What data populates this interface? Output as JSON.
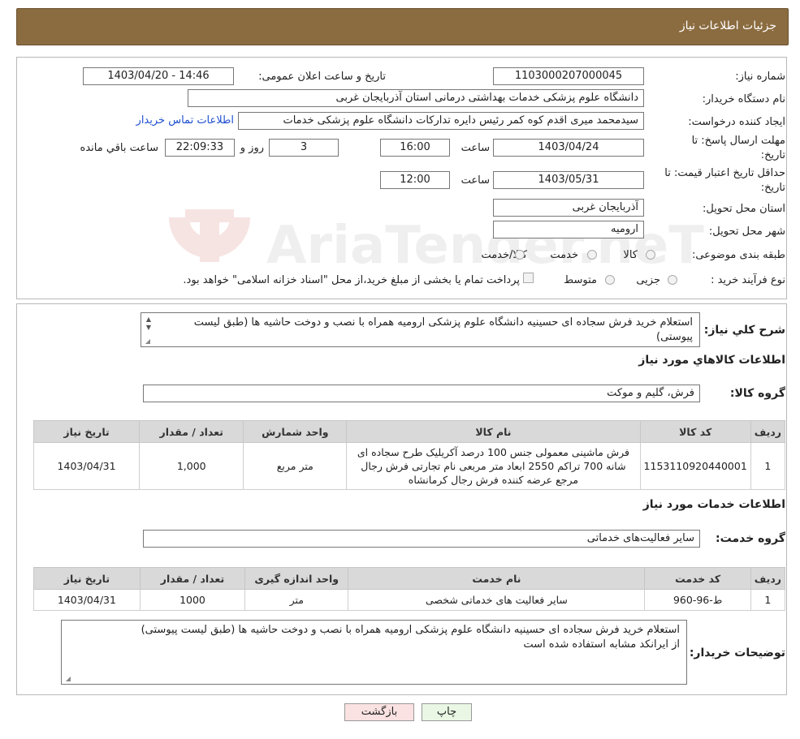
{
  "header": {
    "title": "جزئیات اطلاعات نیاز"
  },
  "watermark": {
    "text": "AriaTender.neT"
  },
  "info": {
    "need_number_label": "شماره نیاز:",
    "need_number": "1103000207000045",
    "announce_label": "تاریخ و ساعت اعلان عمومی:",
    "announce_value": "1403/04/20 - 14:46",
    "buyer_org_label": "نام دستگاه خریدار:",
    "buyer_org": "دانشگاه علوم پزشکی خدمات بهداشتی درمانی استان آذربایجان غربی",
    "creator_label": "ایجاد کننده درخواست:",
    "creator": "سیدمحمد میری اقدم کوه کمر رئیس دایره تدارکات دانشگاه علوم پزشکی خدمات",
    "contact_link": "اطلاعات تماس خریدار",
    "deadline_label_1": "مهلت ارسال پاسخ: تا",
    "deadline_label_2": "تاریخ:",
    "deadline_date": "1403/04/24",
    "time_label": "ساعت",
    "deadline_time": "16:00",
    "days_count": "3",
    "days_label": "روز و",
    "remaining_time": "22:09:33",
    "remaining_label": "ساعت باقي مانده",
    "validity_label_1": "حداقل تاریخ اعتبار قیمت: تا",
    "validity_label_2": "تاریخ:",
    "validity_date": "1403/05/31",
    "validity_time": "12:00",
    "province_label": "استان محل تحویل:",
    "province": "آذربایجان غربی",
    "city_label": "شهر محل تحویل:",
    "city": "ارومیه",
    "category_label": "طبقه بندی موضوعی:",
    "category_options": [
      "کالا",
      "خدمت",
      "کالا/خدمت"
    ],
    "process_label": "نوع فرآیند خرید :",
    "process_options": [
      "جزیی",
      "متوسط"
    ],
    "process_note": "پرداخت تمام یا بخشی از مبلغ خرید،از محل \"اسناد خزانه اسلامی\" خواهد بود."
  },
  "summary": {
    "label": "شرح کلي نياز:",
    "text": "استعلام خرید فرش سجاده ای حسینیه دانشگاه علوم پزشکی ارومیه همراه با نصب و دوخت حاشیه ها (طبق لیست پیوستی)"
  },
  "goods": {
    "section_title": "اطلاعات کالاهاي مورد نياز",
    "group_label": "گروه کالا:",
    "group_value": "فرش، گلیم و موکت",
    "headers": [
      "رديف",
      "کد کالا",
      "نام کالا",
      "واحد شمارش",
      "تعداد / مقدار",
      "تاریخ نیاز"
    ],
    "rows": [
      {
        "row": "1",
        "code": "1153110920440001",
        "name": "فرش ماشینی معمولی جنس 100 درصد آکریلیک طرح سجاده ای شانه 700 تراکم 2550 ابعاد متر مربعی نام تجارتی فرش رجال مرجع عرضه کننده فرش رجال کرمانشاه",
        "unit": "متر مربع",
        "qty": "1,000",
        "date": "1403/04/31"
      }
    ]
  },
  "services": {
    "section_title": "اطلاعات خدمات مورد نياز",
    "group_label": "گروه خدمت:",
    "group_value": "سایر فعالیت‌های خدماتی",
    "headers": [
      "رديف",
      "کد خدمت",
      "نام خدمت",
      "واحد اندازه گیری",
      "تعداد / مقدار",
      "تاریخ نیاز"
    ],
    "rows": [
      {
        "row": "1",
        "code": "ط-96-960",
        "name": "سایر فعالیت های خدماتی شخصی",
        "unit": "متر",
        "qty": "1000",
        "date": "1403/04/31"
      }
    ]
  },
  "buyer_notes": {
    "label": "توضیحات خریدار:",
    "line1": "استعلام خرید فرش سجاده ای حسینیه دانشگاه علوم پزشکی ارومیه همراه با نصب و دوخت حاشیه ها (طبق لیست پیوستی)",
    "line2": "از ایرانکد مشابه استفاده شده است"
  },
  "buttons": {
    "print": "چاپ",
    "back": "بازگشت"
  },
  "colors": {
    "header_bg": "#8b6c40",
    "print_bg": "#e9f7e4",
    "back_bg": "#fbe2e2",
    "link": "#1f4fd1"
  }
}
